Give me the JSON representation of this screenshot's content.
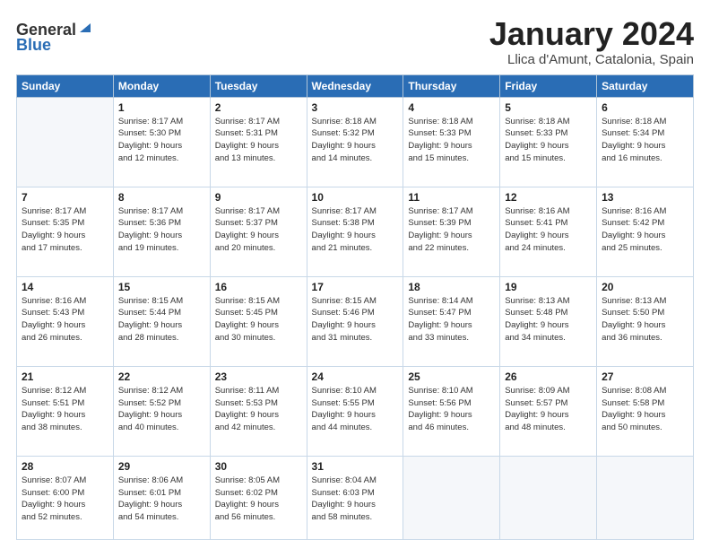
{
  "header": {
    "logo_line1": "General",
    "logo_line2": "Blue",
    "month_title": "January 2024",
    "subtitle": "Llica d'Amunt, Catalonia, Spain"
  },
  "weekdays": [
    "Sunday",
    "Monday",
    "Tuesday",
    "Wednesday",
    "Thursday",
    "Friday",
    "Saturday"
  ],
  "weeks": [
    [
      {
        "day": "",
        "info": ""
      },
      {
        "day": "1",
        "info": "Sunrise: 8:17 AM\nSunset: 5:30 PM\nDaylight: 9 hours\nand 12 minutes."
      },
      {
        "day": "2",
        "info": "Sunrise: 8:17 AM\nSunset: 5:31 PM\nDaylight: 9 hours\nand 13 minutes."
      },
      {
        "day": "3",
        "info": "Sunrise: 8:18 AM\nSunset: 5:32 PM\nDaylight: 9 hours\nand 14 minutes."
      },
      {
        "day": "4",
        "info": "Sunrise: 8:18 AM\nSunset: 5:33 PM\nDaylight: 9 hours\nand 15 minutes."
      },
      {
        "day": "5",
        "info": "Sunrise: 8:18 AM\nSunset: 5:33 PM\nDaylight: 9 hours\nand 15 minutes."
      },
      {
        "day": "6",
        "info": "Sunrise: 8:18 AM\nSunset: 5:34 PM\nDaylight: 9 hours\nand 16 minutes."
      }
    ],
    [
      {
        "day": "7",
        "info": "Sunrise: 8:17 AM\nSunset: 5:35 PM\nDaylight: 9 hours\nand 17 minutes."
      },
      {
        "day": "8",
        "info": "Sunrise: 8:17 AM\nSunset: 5:36 PM\nDaylight: 9 hours\nand 19 minutes."
      },
      {
        "day": "9",
        "info": "Sunrise: 8:17 AM\nSunset: 5:37 PM\nDaylight: 9 hours\nand 20 minutes."
      },
      {
        "day": "10",
        "info": "Sunrise: 8:17 AM\nSunset: 5:38 PM\nDaylight: 9 hours\nand 21 minutes."
      },
      {
        "day": "11",
        "info": "Sunrise: 8:17 AM\nSunset: 5:39 PM\nDaylight: 9 hours\nand 22 minutes."
      },
      {
        "day": "12",
        "info": "Sunrise: 8:16 AM\nSunset: 5:41 PM\nDaylight: 9 hours\nand 24 minutes."
      },
      {
        "day": "13",
        "info": "Sunrise: 8:16 AM\nSunset: 5:42 PM\nDaylight: 9 hours\nand 25 minutes."
      }
    ],
    [
      {
        "day": "14",
        "info": "Sunrise: 8:16 AM\nSunset: 5:43 PM\nDaylight: 9 hours\nand 26 minutes."
      },
      {
        "day": "15",
        "info": "Sunrise: 8:15 AM\nSunset: 5:44 PM\nDaylight: 9 hours\nand 28 minutes."
      },
      {
        "day": "16",
        "info": "Sunrise: 8:15 AM\nSunset: 5:45 PM\nDaylight: 9 hours\nand 30 minutes."
      },
      {
        "day": "17",
        "info": "Sunrise: 8:15 AM\nSunset: 5:46 PM\nDaylight: 9 hours\nand 31 minutes."
      },
      {
        "day": "18",
        "info": "Sunrise: 8:14 AM\nSunset: 5:47 PM\nDaylight: 9 hours\nand 33 minutes."
      },
      {
        "day": "19",
        "info": "Sunrise: 8:13 AM\nSunset: 5:48 PM\nDaylight: 9 hours\nand 34 minutes."
      },
      {
        "day": "20",
        "info": "Sunrise: 8:13 AM\nSunset: 5:50 PM\nDaylight: 9 hours\nand 36 minutes."
      }
    ],
    [
      {
        "day": "21",
        "info": "Sunrise: 8:12 AM\nSunset: 5:51 PM\nDaylight: 9 hours\nand 38 minutes."
      },
      {
        "day": "22",
        "info": "Sunrise: 8:12 AM\nSunset: 5:52 PM\nDaylight: 9 hours\nand 40 minutes."
      },
      {
        "day": "23",
        "info": "Sunrise: 8:11 AM\nSunset: 5:53 PM\nDaylight: 9 hours\nand 42 minutes."
      },
      {
        "day": "24",
        "info": "Sunrise: 8:10 AM\nSunset: 5:55 PM\nDaylight: 9 hours\nand 44 minutes."
      },
      {
        "day": "25",
        "info": "Sunrise: 8:10 AM\nSunset: 5:56 PM\nDaylight: 9 hours\nand 46 minutes."
      },
      {
        "day": "26",
        "info": "Sunrise: 8:09 AM\nSunset: 5:57 PM\nDaylight: 9 hours\nand 48 minutes."
      },
      {
        "day": "27",
        "info": "Sunrise: 8:08 AM\nSunset: 5:58 PM\nDaylight: 9 hours\nand 50 minutes."
      }
    ],
    [
      {
        "day": "28",
        "info": "Sunrise: 8:07 AM\nSunset: 6:00 PM\nDaylight: 9 hours\nand 52 minutes."
      },
      {
        "day": "29",
        "info": "Sunrise: 8:06 AM\nSunset: 6:01 PM\nDaylight: 9 hours\nand 54 minutes."
      },
      {
        "day": "30",
        "info": "Sunrise: 8:05 AM\nSunset: 6:02 PM\nDaylight: 9 hours\nand 56 minutes."
      },
      {
        "day": "31",
        "info": "Sunrise: 8:04 AM\nSunset: 6:03 PM\nDaylight: 9 hours\nand 58 minutes."
      },
      {
        "day": "",
        "info": ""
      },
      {
        "day": "",
        "info": ""
      },
      {
        "day": "",
        "info": ""
      }
    ]
  ]
}
